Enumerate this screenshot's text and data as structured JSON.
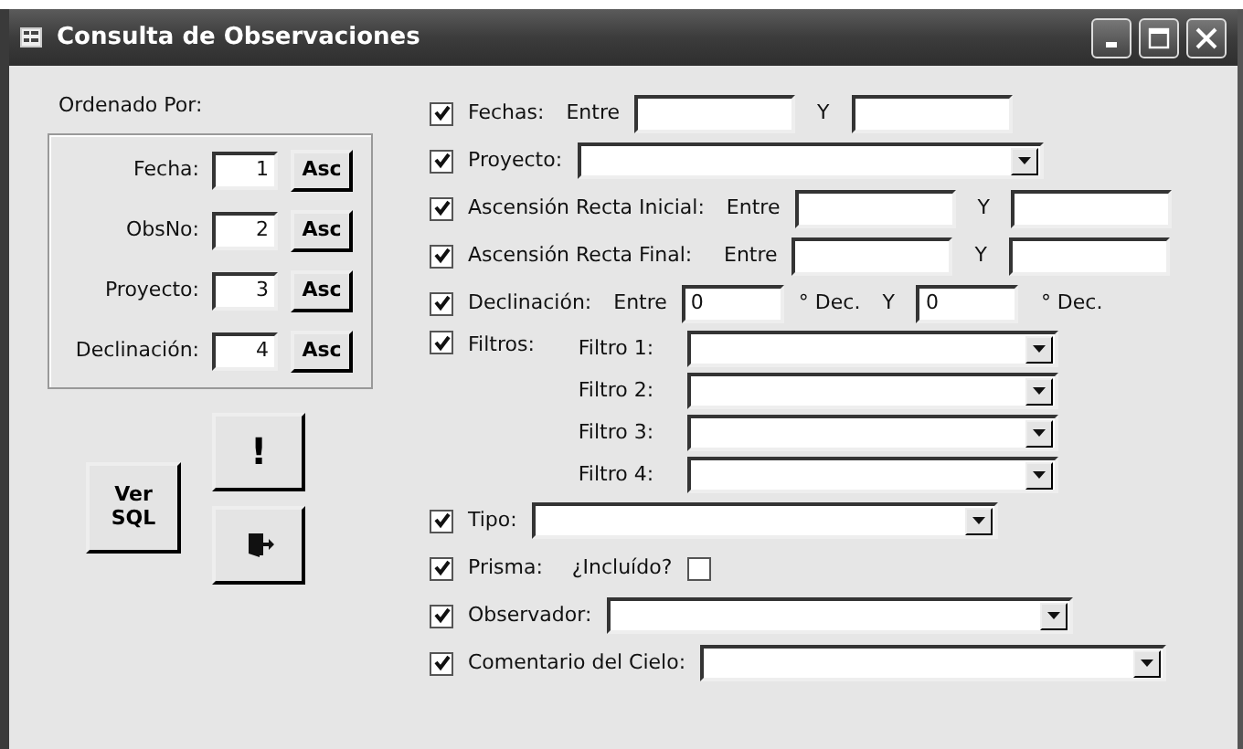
{
  "window": {
    "title": "Consulta de Observaciones"
  },
  "order": {
    "title": "Ordenado Por:",
    "fields": [
      {
        "label": "Fecha:",
        "value": "1",
        "button": "Asc"
      },
      {
        "label": "ObsNo:",
        "value": "2",
        "button": "Asc"
      },
      {
        "label": "Proyecto:",
        "value": "3",
        "button": "Asc"
      },
      {
        "label": "Declinación:",
        "value": "4",
        "button": "Asc"
      }
    ]
  },
  "actions": {
    "sql_button": "Ver SQL",
    "run_button": "!"
  },
  "criteria": [
    {
      "kind": "range",
      "checked": true,
      "label": "Fechas:",
      "from_label": "Entre",
      "to_label": "Y"
    },
    {
      "kind": "combo",
      "checked": true,
      "label": "Proyecto:"
    },
    {
      "kind": "range",
      "checked": true,
      "label": "Ascensión Recta Inicial:",
      "from_label": "Entre",
      "to_label": "Y"
    },
    {
      "kind": "range",
      "checked": true,
      "label": "Ascensión Recta Final:",
      "from_label": "Entre",
      "to_label": "Y"
    },
    {
      "kind": "range",
      "checked": true,
      "label": "Declinación:",
      "from_label": "Entre",
      "from_value": "0",
      "from_unit": "° Dec.",
      "to_label": "Y",
      "to_value": "0",
      "to_unit": "° Dec."
    },
    {
      "kind": "filters",
      "checked": true,
      "label": "Filtros:",
      "combos": [
        {
          "label": "Filtro 1:"
        },
        {
          "label": "Filtro 2:"
        },
        {
          "label": "Filtro 3:"
        },
        {
          "label": "Filtro 4:"
        }
      ]
    },
    {
      "kind": "combo",
      "checked": true,
      "label": "Tipo:"
    },
    {
      "kind": "toggle",
      "checked": true,
      "label": "Prisma:",
      "question": "¿Incluído?",
      "value": false
    },
    {
      "kind": "combo",
      "checked": true,
      "label": "Observador:"
    },
    {
      "kind": "combo",
      "checked": true,
      "label": "Comentario del Cielo:"
    }
  ]
}
